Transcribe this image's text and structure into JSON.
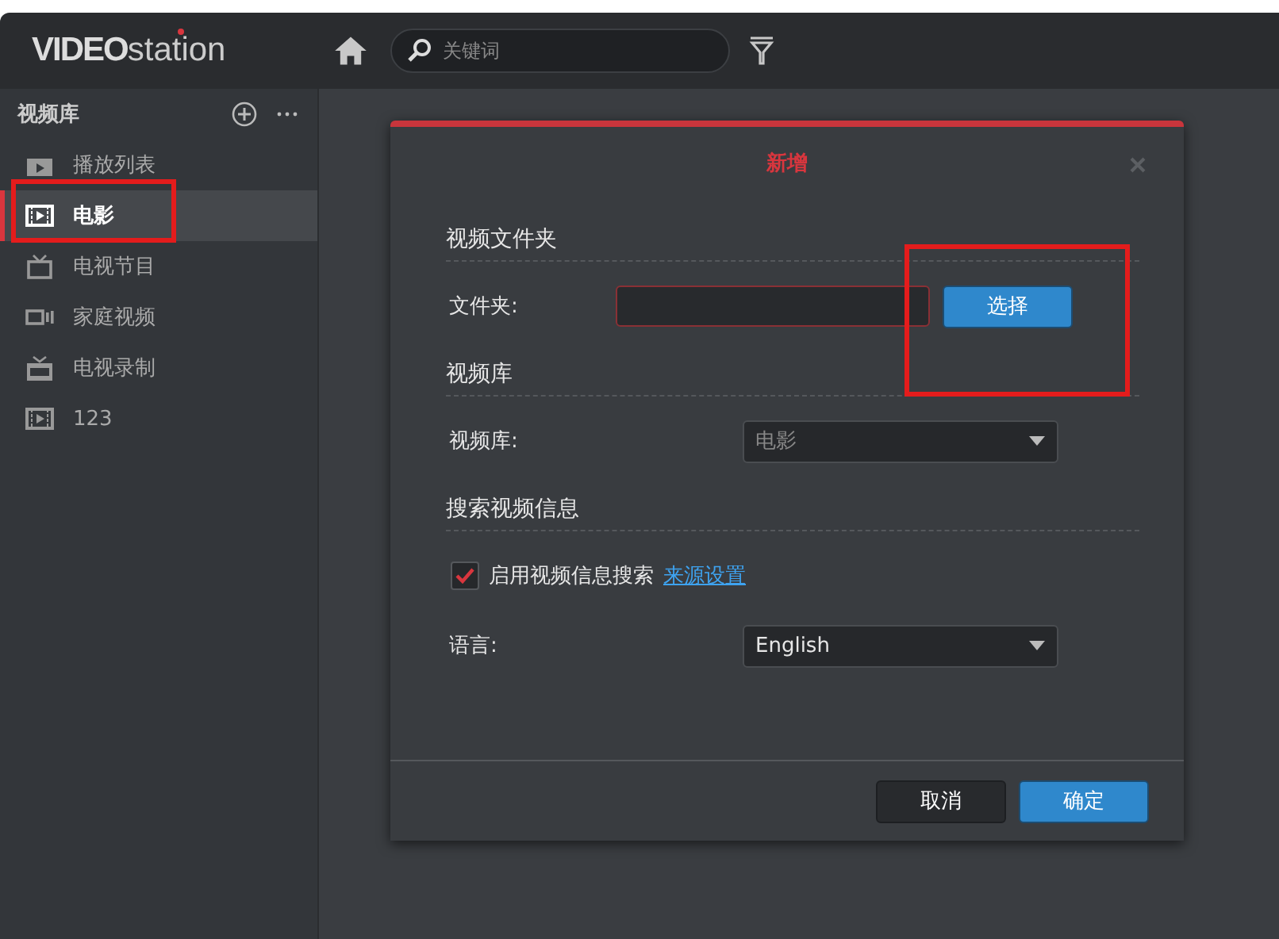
{
  "header": {
    "logo_bold": "VIDEO",
    "logo_light": "station",
    "search": {
      "placeholder": "关键词"
    }
  },
  "sidebar": {
    "title": "视频库",
    "items": [
      {
        "label": "播放列表",
        "selected": false
      },
      {
        "label": "电影",
        "selected": true
      },
      {
        "label": "电视节目",
        "selected": false
      },
      {
        "label": "家庭视频",
        "selected": false
      },
      {
        "label": "电视录制",
        "selected": false
      },
      {
        "label": "123",
        "selected": false
      }
    ]
  },
  "dialog": {
    "title": "新增",
    "sections": [
      {
        "title": "视频文件夹",
        "rows": [
          {
            "kind": "folder",
            "label": "文件夹:",
            "button": "选择"
          }
        ]
      },
      {
        "title": "视频库",
        "rows": [
          {
            "kind": "select",
            "label": "视频库:",
            "value": "电影",
            "disabled": true
          }
        ]
      },
      {
        "title": "搜索视频信息",
        "rows": [
          {
            "kind": "checkbox",
            "label": "启用视频信息搜索",
            "link": "来源设置",
            "checked": true
          },
          {
            "kind": "select",
            "label": "语言:",
            "value": "English",
            "disabled": false
          }
        ]
      }
    ],
    "buttons": [
      {
        "label": "取消",
        "primary": false
      },
      {
        "label": "确定",
        "primary": true
      }
    ]
  }
}
